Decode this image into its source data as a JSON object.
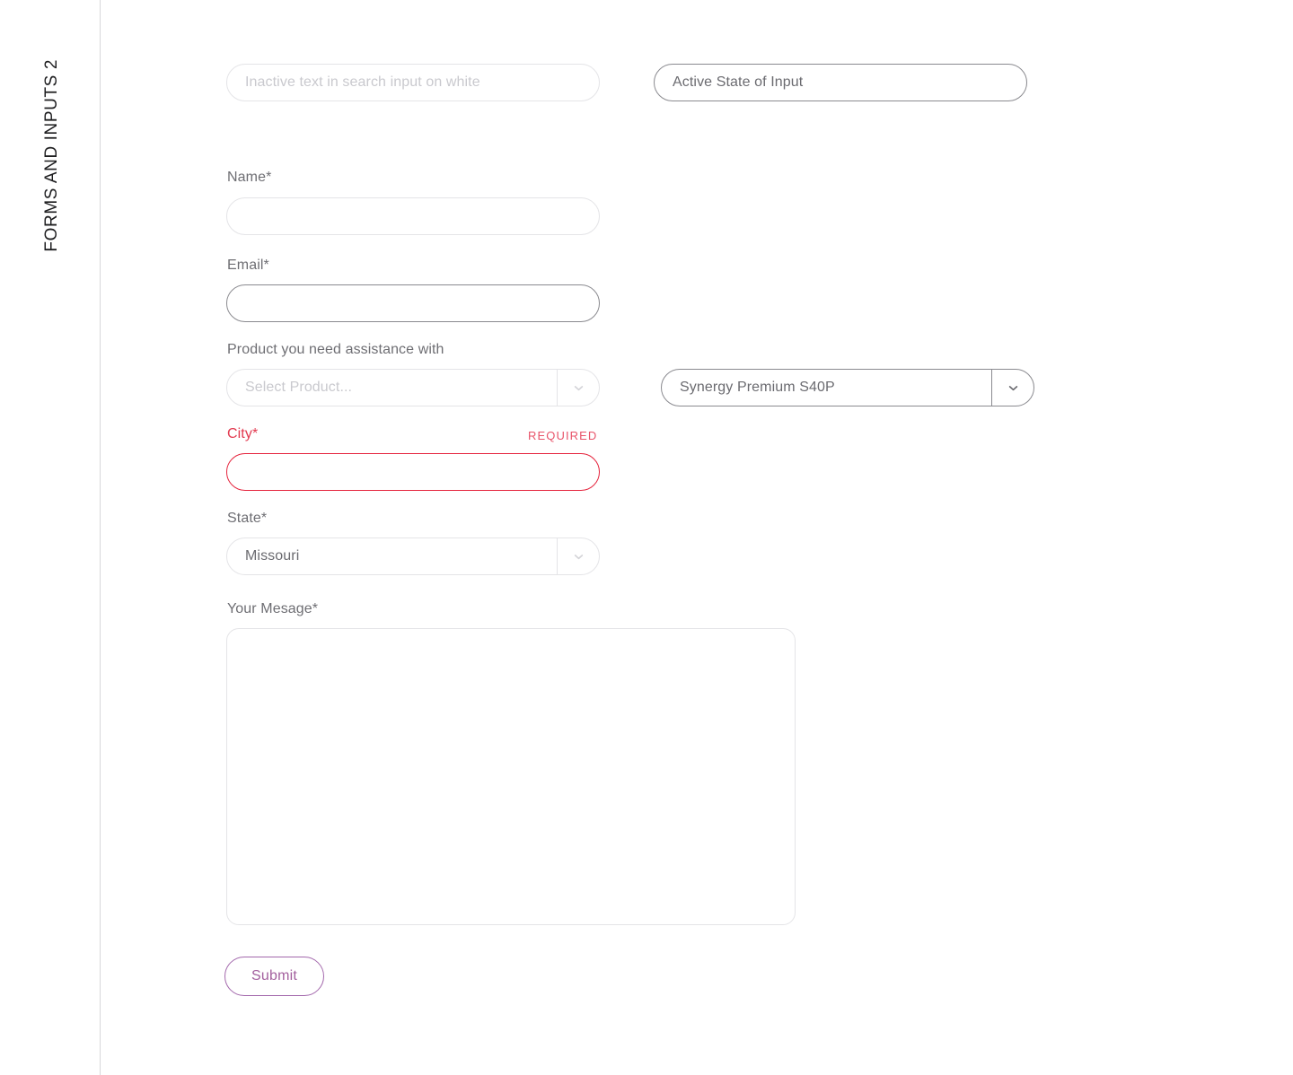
{
  "sidebar": {
    "title": "FORMS AND INPUTS 2"
  },
  "colors": {
    "error": "#e23a50",
    "error_border": "#e5243d",
    "required_text": "#e8546a",
    "submit_accent": "#a3609e",
    "label": "#6e6e73",
    "border_inactive": "#e4e4e7",
    "border_active": "#8a8a8f",
    "placeholder": "#c9c9ce",
    "value_text": "#6b6b70",
    "rail_divider": "#d7d7da"
  },
  "search_row": {
    "inactive_search": {
      "placeholder": "Inactive text in search input on white",
      "value": "",
      "state": "inactive"
    },
    "active_search": {
      "placeholder": "",
      "value": "Active State of Input",
      "state": "active"
    }
  },
  "form": {
    "name": {
      "label": "Name*",
      "value": "",
      "placeholder": "",
      "state": "inactive"
    },
    "email": {
      "label": "Email*",
      "value": "",
      "placeholder": "",
      "state": "active"
    },
    "product": {
      "label": "Product you need assistance with",
      "placeholder": "Select Product...",
      "value": "",
      "state": "inactive",
      "arrow_icon": "chevron-down-icon"
    },
    "product_active": {
      "value": "Synergy Premium S40P",
      "state": "active",
      "arrow_icon": "chevron-down-icon"
    },
    "city": {
      "label": "City*",
      "required_flag": "REQUIRED",
      "value": "",
      "placeholder": "",
      "state": "error"
    },
    "state": {
      "label": "State*",
      "value": "Missouri",
      "placeholder": "",
      "state": "inactive",
      "arrow_icon": "chevron-down-icon"
    },
    "message": {
      "label": "Your Mesage*",
      "value": "",
      "placeholder": ""
    },
    "submit": {
      "label": "Submit"
    }
  }
}
